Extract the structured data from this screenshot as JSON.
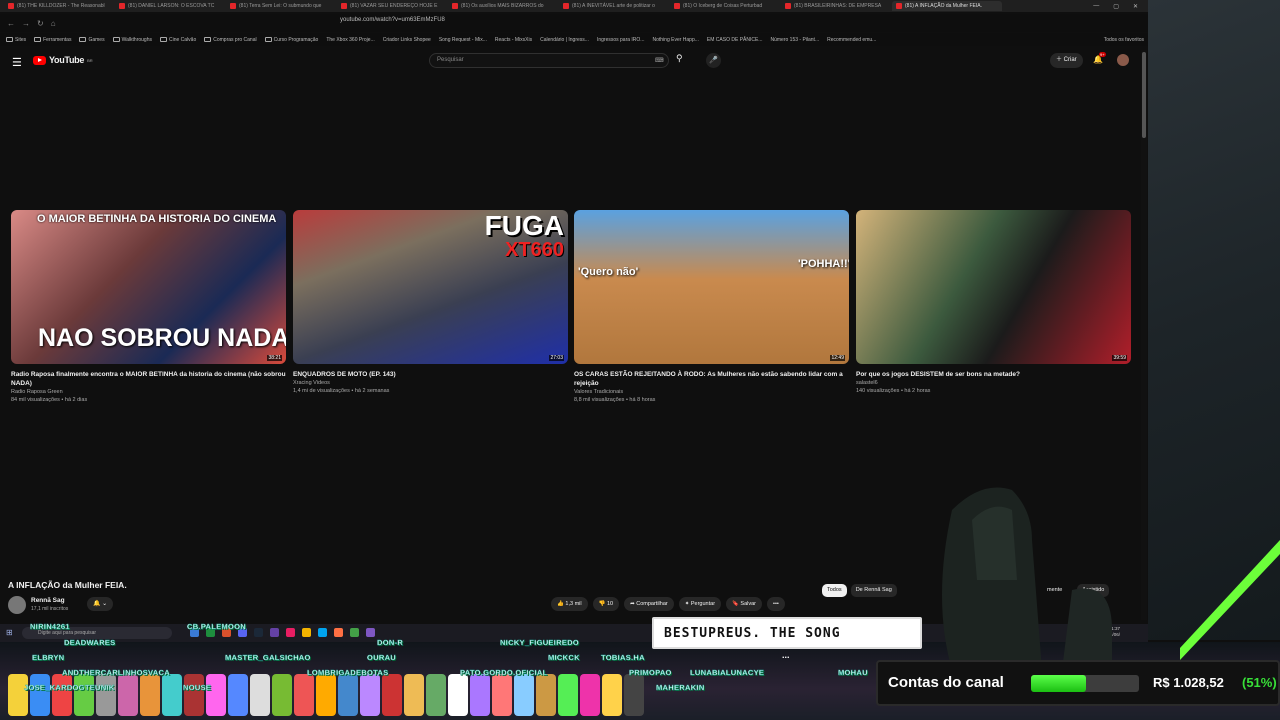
{
  "browser": {
    "tabs": [
      {
        "label": "(81) THE KILLDOZER - The Reasonabl"
      },
      {
        "label": "(81) DANIEL LARSON: O ESCOVA TC"
      },
      {
        "label": "(81) Terra Sem Lei: O submundo que"
      },
      {
        "label": "(81) VAZAR SEU ENDEREÇO HOJE E"
      },
      {
        "label": "(81) Os auxílios MAIS BIZARROS do"
      },
      {
        "label": "(81) A INEVITÁVEL arte de politizar o"
      },
      {
        "label": "(81) O Iceberg de Coisas Perturbad"
      },
      {
        "label": "(81) BRASILEIRINHAS: DE EMPRESA"
      },
      {
        "label": "(81) A INFLAÇÃO da Mulher FEIA."
      }
    ],
    "url": "youtube.com/watch?v=um63EmMzFU8",
    "bookmarks": [
      "Sites",
      "Ferramentas",
      "Games",
      "Walkthroughs",
      "Cine Calvão",
      "Compras pro Canal",
      "Curso Programação",
      "The Xbox 360 Proje...",
      "Criador Links Shopee",
      "Song Request - Mix...",
      "Reacts - MixsXis",
      "Calendário | Ingress...",
      "Ingressos para IRO...",
      "Nothing Ever Happ...",
      "EM CASO DE PÂNICE...",
      "Número 153 - Pilant...",
      "Recommended emu..."
    ],
    "bookmarks_all": "Todos os favoritos"
  },
  "youtube": {
    "logo": "YouTube",
    "logo_country": "BR",
    "search_placeholder": "Pesquisar",
    "create_label": "Criar",
    "notif_badge": "9+",
    "videos": [
      {
        "title": "Radio Raposa finalmente encontra o MAIOR BETINHA da historia do cinema (não sobrou NADA)",
        "channel": "Radio Raposa Green",
        "meta": "84 mil visualizações • há 2 dias",
        "duration": "38:21",
        "overlay_top": "O MAIOR BETINHA DA HISTORIA DO CINEMA",
        "overlay_big": "NAO SOBROU NADA!"
      },
      {
        "title": "ENQUADROS DE MOTO (EP. 143)",
        "channel": "Xracing Videos",
        "meta": "1,4 mi de visualizações • há 2 semanas",
        "duration": "27:03",
        "overlay_top": "FUGA",
        "overlay_big": "XT660"
      },
      {
        "title": "OS CARAS ESTÃO REJEITANDO À RODO: As Mulheres não estão sabendo lidar com a rejeição",
        "channel": "Valores Tradicionais",
        "meta": "8,8 mil visualizações • há 8 horas",
        "duration": "12:49",
        "overlay_top": "'Quero não'",
        "overlay_big": "'POHHA!!'"
      },
      {
        "title": "Por que os jogos DESISTEM de ser bons na metade?",
        "channel": "salastel6",
        "meta": "140 visualizações • há 2 horas",
        "duration": "39:59"
      }
    ],
    "watch": {
      "title": "A INFLAÇÃO da Mulher FEIA.",
      "channel": "Rennã Sag",
      "subs": "17,1 mil inscritos",
      "likes": "1,3 mil",
      "dislikes": "10",
      "share": "Compartilhar",
      "ask": "Perguntar",
      "save": "Salvar",
      "more": "•••"
    },
    "chips": [
      "Todos",
      "De Rennã Sag",
      "mente",
      "Assistido"
    ]
  },
  "taskbar": {
    "search_placeholder": "Digite aqui para pesquisar",
    "clock_time": "21:37",
    "clock_date": "16/06/",
    "lang": "POR",
    "lang2": "PTB2"
  },
  "stream_overlay": {
    "chat_message": "BESTUPREUS. THE SONG",
    "chat_dots": "...",
    "usernames": [
      "NIRIN4261",
      "CB.PALEMOON",
      "DEADWARES",
      "DON-R",
      "NICKY_FIGUEIREDO",
      "ELBRYN",
      "MASTER_GALSICHAO",
      "OURAU",
      "MICKCK",
      "TOBIAS.HA",
      "ANDTHERCARLINHOSVACA",
      "LOMBRIGADEBOTAS",
      "PATO.GORDO.OFICIAL",
      "LUNABIALUNACYE",
      "MOHAU",
      "PRIMOPAO",
      "JOSE_KARDOGTEUNIK",
      "NOUSE",
      "MAHERAKIN"
    ],
    "donation_label": "Contas do canal",
    "donation_value": "R$ 1.028,52",
    "donation_pct": "(51%)",
    "donation_fraction": 0.51,
    "accent": "#38e038"
  }
}
